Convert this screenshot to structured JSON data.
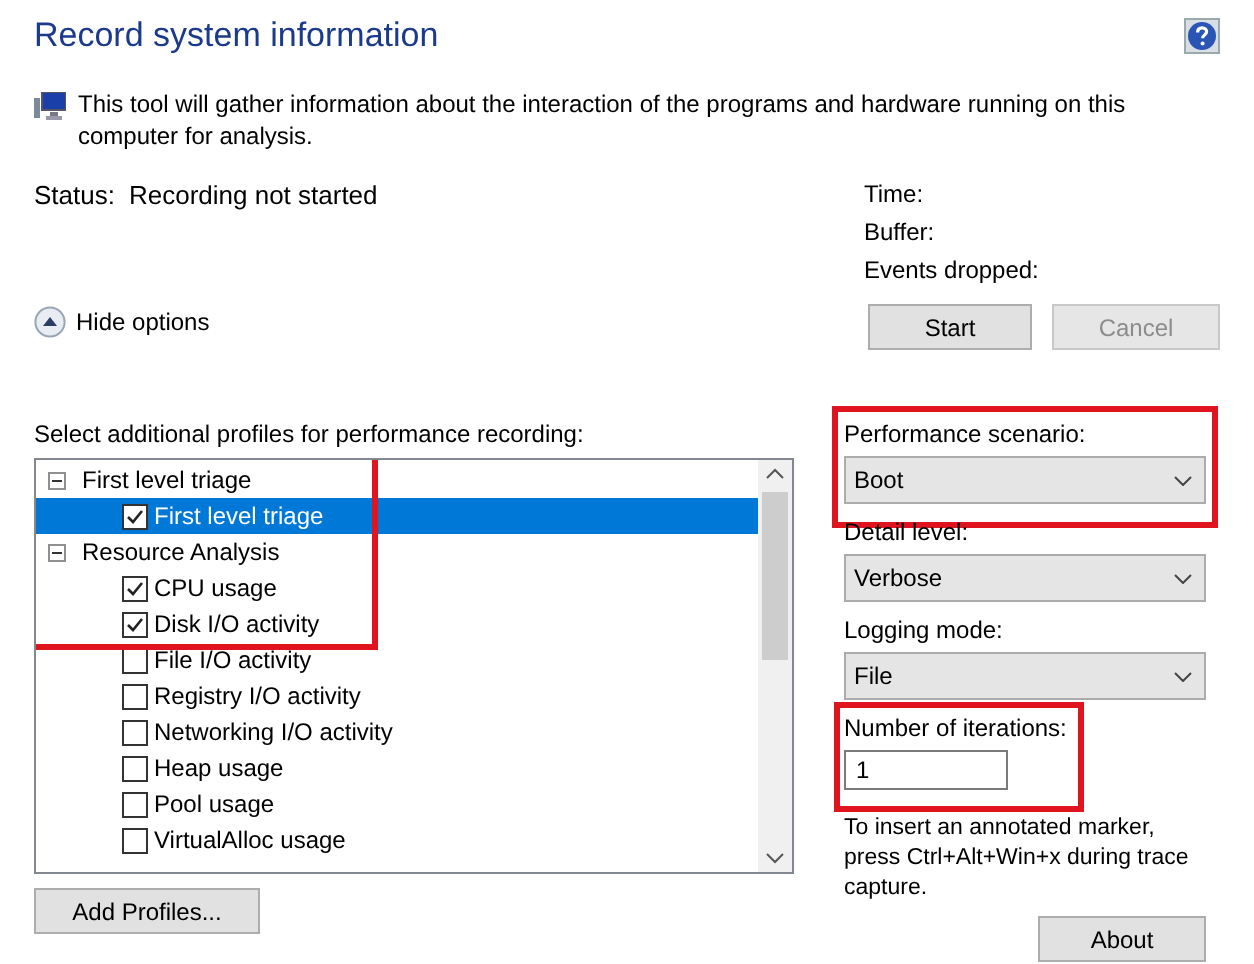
{
  "title": "Record system information",
  "intro": "This tool will gather information about the interaction of the programs and hardware running on this computer for analysis.",
  "status": {
    "label": "Status:",
    "value": "Recording not started"
  },
  "stats": [
    "Time:",
    "Buffer:",
    "Events dropped:"
  ],
  "buttons": [
    {
      "label": "Start",
      "disabled": false
    },
    {
      "label": "Cancel",
      "disabled": true
    }
  ],
  "options_toggle": {
    "label": "Hide options",
    "expanded": true
  },
  "profiles": {
    "label": "Select additional profiles for performance recording:",
    "groups": [
      {
        "label": "First level triage",
        "expanded": true,
        "children": [
          {
            "label": "First level triage",
            "checked": true,
            "selected": true
          }
        ]
      },
      {
        "label": "Resource Analysis",
        "expanded": true,
        "children": [
          {
            "label": "CPU usage",
            "checked": true,
            "selected": false
          },
          {
            "label": "Disk I/O activity",
            "checked": true,
            "selected": false
          },
          {
            "label": "File I/O activity",
            "checked": false,
            "selected": false
          },
          {
            "label": "Registry I/O activity",
            "checked": false,
            "selected": false
          },
          {
            "label": "Networking I/O activity",
            "checked": false,
            "selected": false
          },
          {
            "label": "Heap usage",
            "checked": false,
            "selected": false
          },
          {
            "label": "Pool usage",
            "checked": false,
            "selected": false
          },
          {
            "label": "VirtualAlloc usage",
            "checked": false,
            "selected": false
          }
        ]
      }
    ],
    "add_button": "Add Profiles..."
  },
  "settings": [
    {
      "kind": "select",
      "label": "Performance scenario:",
      "value": "Boot",
      "highlighted": true
    },
    {
      "kind": "select",
      "label": "Detail level:",
      "value": "Verbose",
      "highlighted": false
    },
    {
      "kind": "select",
      "label": "Logging mode:",
      "value": "File",
      "highlighted": false
    },
    {
      "kind": "input",
      "label": "Number of iterations:",
      "value": "1",
      "highlighted": true
    }
  ],
  "hint": "To insert an annotated marker, press Ctrl+Alt+Win+x during trace capture.",
  "about_button": "About"
}
